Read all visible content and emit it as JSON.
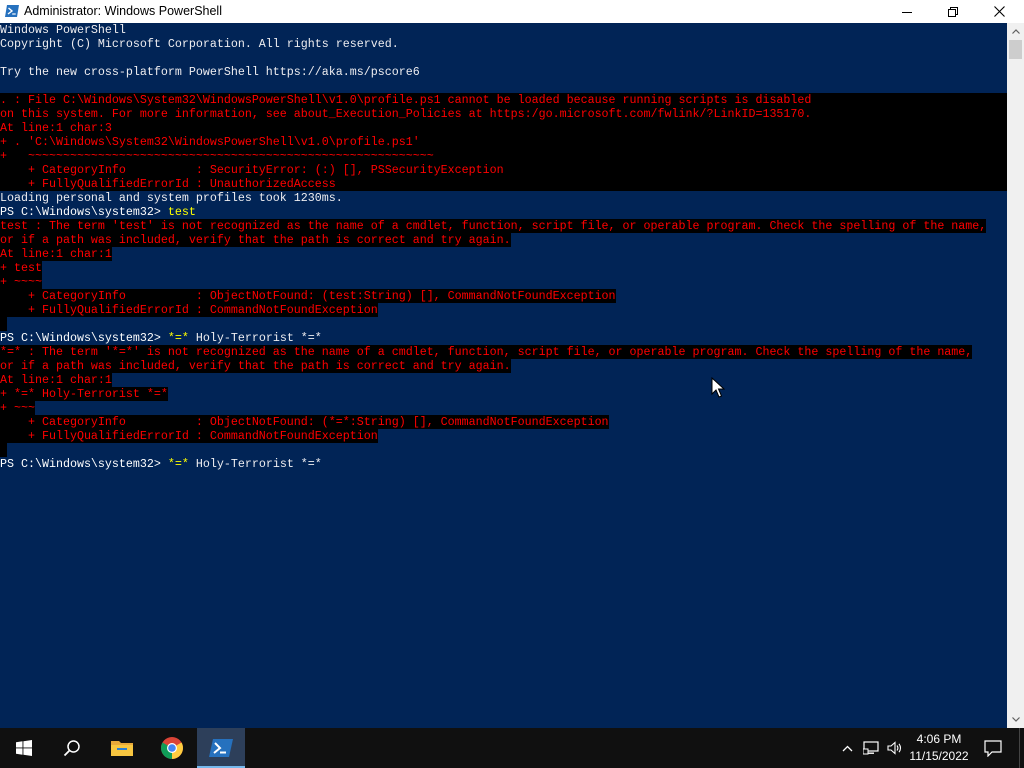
{
  "window": {
    "title": "Administrator: Windows PowerShell"
  },
  "console": {
    "lines": [
      {
        "style": "normal",
        "text": "Windows PowerShell"
      },
      {
        "style": "normal",
        "text": "Copyright (C) Microsoft Corporation. All rights reserved."
      },
      {
        "style": "normal",
        "text": ""
      },
      {
        "style": "normal",
        "text": "Try the new cross-platform PowerShell https://aka.ms/pscore6"
      },
      {
        "style": "normal",
        "text": ""
      },
      {
        "style": "errfull",
        "text": ". : File C:\\Windows\\System32\\WindowsPowerShell\\v1.0\\profile.ps1 cannot be loaded because running scripts is disabled"
      },
      {
        "style": "errfull",
        "text": "on this system. For more information, see about_Execution_Policies at https:/go.microsoft.com/fwlink/?LinkID=135170."
      },
      {
        "style": "errfull",
        "text": "At line:1 char:3"
      },
      {
        "style": "errfull",
        "text": "+ . 'C:\\Windows\\System32\\WindowsPowerShell\\v1.0\\profile.ps1'"
      },
      {
        "style": "errfull",
        "text": "+   ~~~~~~~~~~~~~~~~~~~~~~~~~~~~~~~~~~~~~~~~~~~~~~~~~~~~~~~~~~"
      },
      {
        "style": "errfull",
        "text": "    + CategoryInfo          : SecurityError: (:) [], PSSecurityException"
      },
      {
        "style": "errfull",
        "text": "    + FullyQualifiedErrorId : UnauthorizedAccess"
      },
      {
        "style": "normal",
        "text": "Loading personal and system profiles took 1230ms."
      },
      {
        "style": "prompt",
        "prompt": "PS C:\\Windows\\system32> ",
        "command": "test",
        "args": ""
      },
      {
        "style": "err",
        "text": "test : The term 'test' is not recognized as the name of a cmdlet, function, script file, or operable program. Check the spelling of the name,"
      },
      {
        "style": "err",
        "text": "or if a path was included, verify that the path is correct and try again."
      },
      {
        "style": "err",
        "text": "At line:1 char:1"
      },
      {
        "style": "err",
        "text": "+ test"
      },
      {
        "style": "err",
        "text": "+ ~~~~"
      },
      {
        "style": "err",
        "text": "    + CategoryInfo          : ObjectNotFound: (test:String) [], CommandNotFoundException"
      },
      {
        "style": "err",
        "text": "    + FullyQualifiedErrorId : CommandNotFoundException"
      },
      {
        "style": "err",
        "text": " "
      },
      {
        "style": "prompt",
        "prompt": "PS C:\\Windows\\system32> ",
        "command": "*=*",
        "args": " Holy-Terrorist *=*"
      },
      {
        "style": "err",
        "text": "*=* : The term '*=*' is not recognized as the name of a cmdlet, function, script file, or operable program. Check the spelling of the name,"
      },
      {
        "style": "err",
        "text": "or if a path was included, verify that the path is correct and try again."
      },
      {
        "style": "err",
        "text": "At line:1 char:1"
      },
      {
        "style": "err",
        "text": "+ *=* Holy-Terrorist *=*"
      },
      {
        "style": "err",
        "text": "+ ~~~"
      },
      {
        "style": "err",
        "text": "    + CategoryInfo          : ObjectNotFound: (*=*:String) [], CommandNotFoundException"
      },
      {
        "style": "err",
        "text": "    + FullyQualifiedErrorId : CommandNotFoundException"
      },
      {
        "style": "err",
        "text": " "
      },
      {
        "style": "prompt",
        "prompt": "PS C:\\Windows\\system32> ",
        "command": "*=*",
        "args": " Holy-Terrorist *=*"
      }
    ]
  },
  "taskbar": {
    "icons": [
      "windows-start-icon",
      "search-icon",
      "file-explorer-icon",
      "chrome-icon",
      "powershell-icon"
    ],
    "active_app": "powershell-icon"
  },
  "tray": {
    "time": "4:06 PM",
    "date": "11/15/2022"
  },
  "colors": {
    "console_bg": "#012456",
    "console_fg": "#eeedf0",
    "error_fg": "#ff0000",
    "error_bg": "#000000",
    "command_fg": "#ffff00",
    "taskbar_bg": "#101010"
  }
}
